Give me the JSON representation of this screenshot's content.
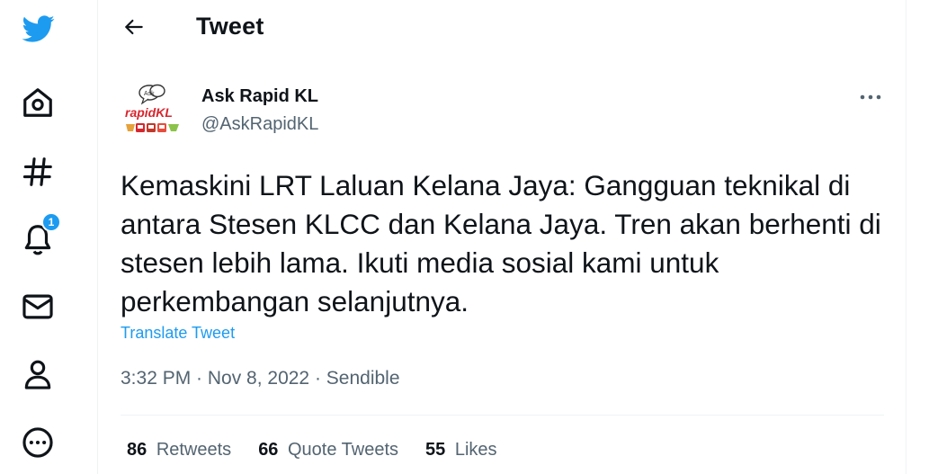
{
  "nav": {
    "items": [
      {
        "icon": "twitter-logo-icon",
        "label": "Twitter"
      },
      {
        "icon": "home-icon",
        "label": "Home"
      },
      {
        "icon": "hashtag-icon",
        "label": "Explore"
      },
      {
        "icon": "bell-icon",
        "label": "Notifications",
        "badge": "1"
      },
      {
        "icon": "mail-icon",
        "label": "Messages"
      },
      {
        "icon": "person-icon",
        "label": "Profile"
      },
      {
        "icon": "more-circle-icon",
        "label": "More"
      }
    ],
    "notifications_badge": "1"
  },
  "header": {
    "back_icon": "arrow-left-icon",
    "title": "Tweet"
  },
  "tweet": {
    "author": {
      "name": "Ask Rapid KL",
      "handle": "@AskRapidKL",
      "avatar_text_top": "Ask",
      "avatar_text_brand": "rapidKL"
    },
    "more_icon": "ellipsis-icon",
    "text": "Kemaskini LRT Laluan Kelana Jaya: Gangguan teknikal di antara Stesen KLCC dan Kelana Jaya. Tren akan berhenti di stesen lebih lama. Ikuti media sosial kami untuk perkembangan selanjutnya.",
    "translate_label": "Translate Tweet",
    "meta": "3:32 PM · Nov 8, 2022 · Sendible",
    "stats": {
      "retweets_count": "86",
      "retweets_label": "Retweets",
      "quote_count": "66",
      "quote_label": "Quote Tweets",
      "likes_count": "55",
      "likes_label": "Likes"
    }
  },
  "colors": {
    "accent": "#1d9bf0",
    "text_primary": "#0f1419",
    "text_secondary": "#536471",
    "border": "#eff3f4",
    "brand_red": "#d7262e"
  }
}
